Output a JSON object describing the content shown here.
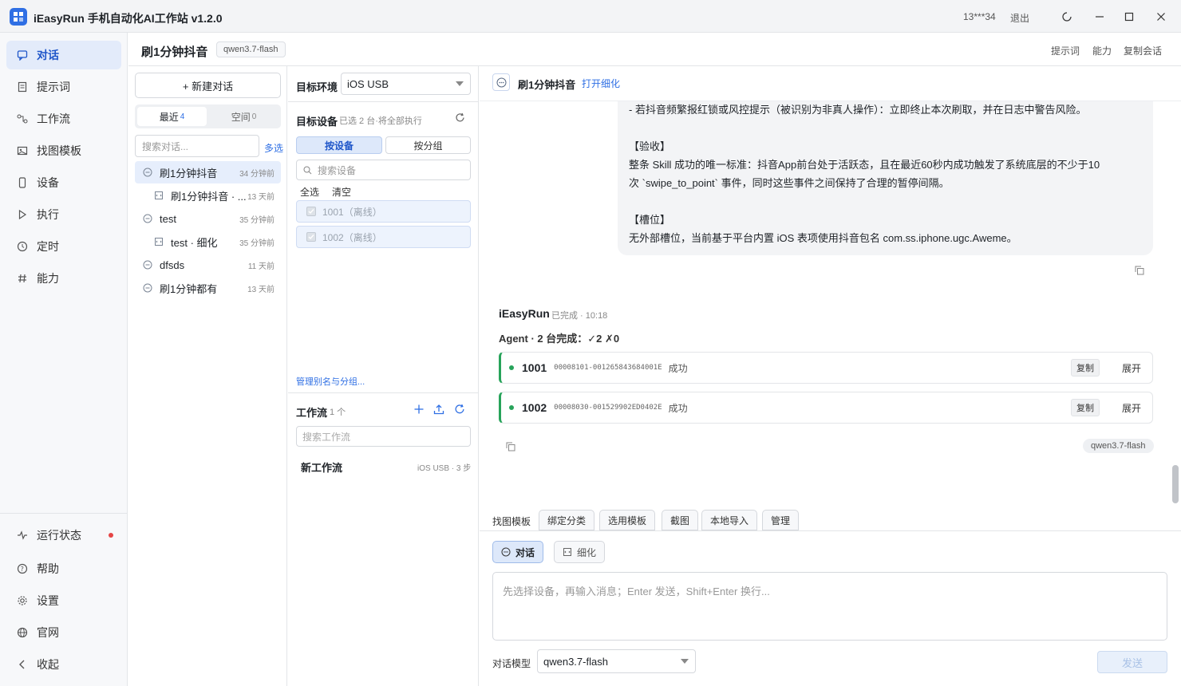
{
  "app": {
    "title": "iEasyRun 手机自动化AI工作站 v1.2.0",
    "user": "13***34",
    "logout": "退出"
  },
  "nav": {
    "items": [
      {
        "label": "对话",
        "icon": "chat-icon"
      },
      {
        "label": "提示词",
        "icon": "document-icon"
      },
      {
        "label": "工作流",
        "icon": "workflow-icon"
      },
      {
        "label": "找图模板",
        "icon": "image-icon"
      },
      {
        "label": "设备",
        "icon": "phone-icon"
      },
      {
        "label": "执行",
        "icon": "play-icon"
      },
      {
        "label": "定时",
        "icon": "clock-icon"
      },
      {
        "label": "能力",
        "icon": "hash-icon"
      }
    ],
    "bottom": [
      {
        "label": "运行状态",
        "icon": "pulse-icon"
      },
      {
        "label": "帮助",
        "icon": "help-icon"
      },
      {
        "label": "设置",
        "icon": "gear-icon"
      },
      {
        "label": "官网",
        "icon": "globe-icon"
      },
      {
        "label": "收起",
        "icon": "chevron-left-icon"
      }
    ]
  },
  "header": {
    "title": "刷1分钟抖音",
    "model": "qwen3.7-flash",
    "links": [
      "提示词",
      "能力",
      "复制会话"
    ]
  },
  "conversations": {
    "new_button": "+ 新建对话",
    "tab_recent": "最近",
    "tab_recent_count": "4",
    "tab_space": "空间",
    "tab_space_count": "0",
    "search_placeholder": "搜索对话...",
    "multi_select": "多选",
    "items": [
      {
        "name": "刷1分钟抖音",
        "time": "34 分钟前",
        "type": "chat"
      },
      {
        "name": "刷1分钟抖音 · ...",
        "time": "13 天前",
        "type": "refine"
      },
      {
        "name": "test",
        "time": "35 分钟前",
        "type": "chat"
      },
      {
        "name": "test · 细化",
        "time": "35 分钟前",
        "type": "refine"
      },
      {
        "name": "dfsds",
        "time": "11 天前",
        "type": "chat"
      },
      {
        "name": "刷1分钟都有",
        "time": "13 天前",
        "type": "chat"
      }
    ]
  },
  "devices": {
    "env_label": "目标环境",
    "env_value": "iOS USB",
    "target_label": "目标设备",
    "target_hint": "已选 2 台·将全部执行",
    "by_device": "按设备",
    "by_group": "按分组",
    "search_placeholder": "搜索设备",
    "select_all": "全选",
    "clear": "清空",
    "list": [
      "1001（离线）",
      "1002（离线）"
    ],
    "manage_link": "管理别名与分组...",
    "workflow_label": "工作流",
    "workflow_count": "1 个",
    "workflow_search_placeholder": "搜索工作流",
    "workflow_item_name": "新工作流",
    "workflow_item_meta": "iOS USB · 3 步"
  },
  "chat": {
    "title": "刷1分钟抖音",
    "open_refine": "打开细化",
    "user_message_lines": [
      "- 若抖音频繁报红锁或风控提示（被识别为非真人操作）：立即终止本次刷取，并在日志中警告风险。",
      "【验收】",
      "整条 Skill 成功的唯一标准：抖音App前台处于活跃态，且在最近60秒内成功触发了系统底层的不少于10",
      "次 `swipe_to_point` 事件，同时这些事件之间保持了合理的暂停间隔。",
      "【槽位】",
      "无外部槽位，当前基于平台内置 iOS 表项使用抖音包名 com.ss.iphone.ugc.Aweme。"
    ],
    "reply_author": "iEasyRun",
    "reply_status": "已完成 · 10:18",
    "agent_summary": "Agent · 2 台完成：✓2 ✗0",
    "results": [
      {
        "id": "1001",
        "serial": "00008101-001265843684001E",
        "status": "成功",
        "copy": "复制",
        "expand": "展开"
      },
      {
        "id": "1002",
        "serial": "00008030-001529902ED0402E",
        "status": "成功",
        "copy": "复制",
        "expand": "展开"
      }
    ],
    "reply_model": "qwen3.7-flash",
    "toolbar_label": "找图模板",
    "toolbar_buttons": [
      "绑定分类",
      "选用模板",
      "截图",
      "本地导入",
      "管理"
    ],
    "mode_chat": "对话",
    "mode_refine": "细化",
    "input_placeholder": "先选择设备，再输入消息；Enter 发送，Shift+Enter 换行...",
    "model_label": "对话模型",
    "model_value": "qwen3.7-flash",
    "send": "发送"
  }
}
